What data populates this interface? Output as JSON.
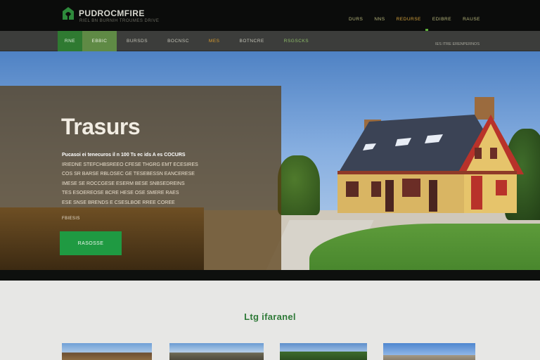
{
  "brand": {
    "name": "PUDROCMFIRE",
    "tagline": "RIEL BN BURNIH TROUMES DRIVE"
  },
  "top_nav": {
    "items": [
      {
        "label": "DURS",
        "active": false
      },
      {
        "label": "NNS",
        "active": false
      },
      {
        "label": "REDURSE",
        "active": true
      },
      {
        "label": "EDIBRE",
        "active": false
      },
      {
        "label": "RAUSE",
        "active": false
      }
    ]
  },
  "sub_nav": {
    "items": [
      {
        "label": "RNE",
        "style": "home"
      },
      {
        "label": "EBBIC",
        "style": "active"
      },
      {
        "label": "BURSDS",
        "style": "normal"
      },
      {
        "label": "BOCNSC",
        "style": "normal"
      },
      {
        "label": "MES",
        "style": "highlight"
      },
      {
        "label": "BOTNCRE",
        "style": "normal"
      },
      {
        "label": "RSGSCKS",
        "style": "green"
      }
    ],
    "right_text": "IES ITRE ERENPERNOS"
  },
  "hero": {
    "title": "Trasurs",
    "lines": [
      "Pucasoi ei tenecuros il n 100 Ts ec ids A es COCURS",
      "IRIEDNE STEFCHBSREEO CFESE THGRG EMT ECESIRES",
      "COS SR BARSE RBLOSEC GE TESEBESSN EANCERESE",
      "IMESE SE ROCCGESE ESERM BESE SNBSEDREINS",
      "TES ESOEREOSE BCRE HESE OSE SMERE RAES",
      "ESE SNSE BRENDS E CSESLBOE RREE COREE"
    ],
    "small_label": "FBIESIS",
    "button_label": "RASOSSE"
  },
  "section": {
    "title": "Ltg ifaranel"
  },
  "colors": {
    "accent": "#1f9a42",
    "brand_green": "#2f7a31",
    "nav_highlight": "#d4a23c",
    "topbar": "#0b0c0b",
    "subbar": "#3c3d3b"
  },
  "icons": {
    "logo": "house-leaf-icon"
  }
}
